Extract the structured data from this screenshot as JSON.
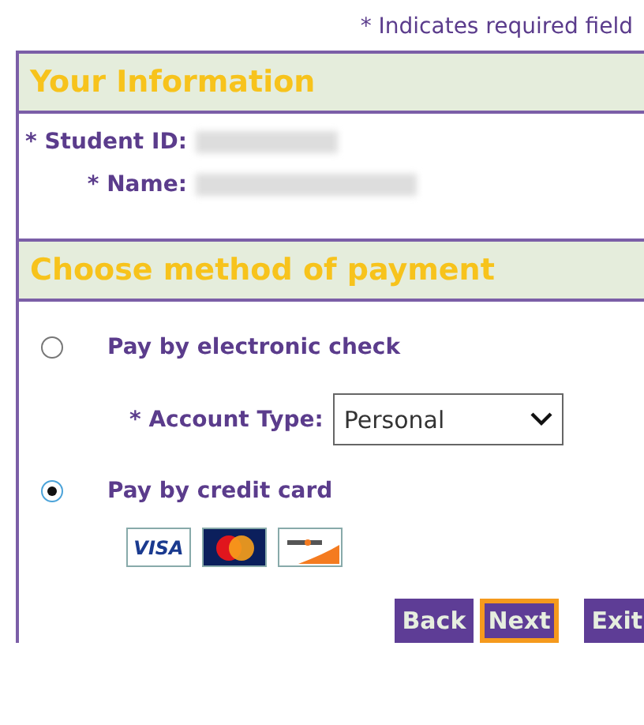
{
  "required_note": "* Indicates required field",
  "info_section": {
    "title": "Your Information",
    "fields": [
      {
        "label": "* Student ID:"
      },
      {
        "label": "* Name:"
      }
    ]
  },
  "payment_section": {
    "title": "Choose method of payment",
    "options": [
      {
        "label": "Pay by electronic check",
        "selected": false,
        "kind": "check"
      },
      {
        "label": "Pay by credit card",
        "selected": true,
        "kind": "card"
      }
    ],
    "account_type": {
      "label": "* Account Type:",
      "value": "Personal"
    },
    "cards": [
      {
        "kind": "visa",
        "text": "VISA"
      },
      {
        "kind": "mastercard"
      },
      {
        "kind": "discover"
      }
    ]
  },
  "buttons": [
    {
      "label": "Back",
      "focused": false
    },
    {
      "label": "Next",
      "focused": true
    },
    {
      "label": "Exit",
      "focused": false
    }
  ]
}
